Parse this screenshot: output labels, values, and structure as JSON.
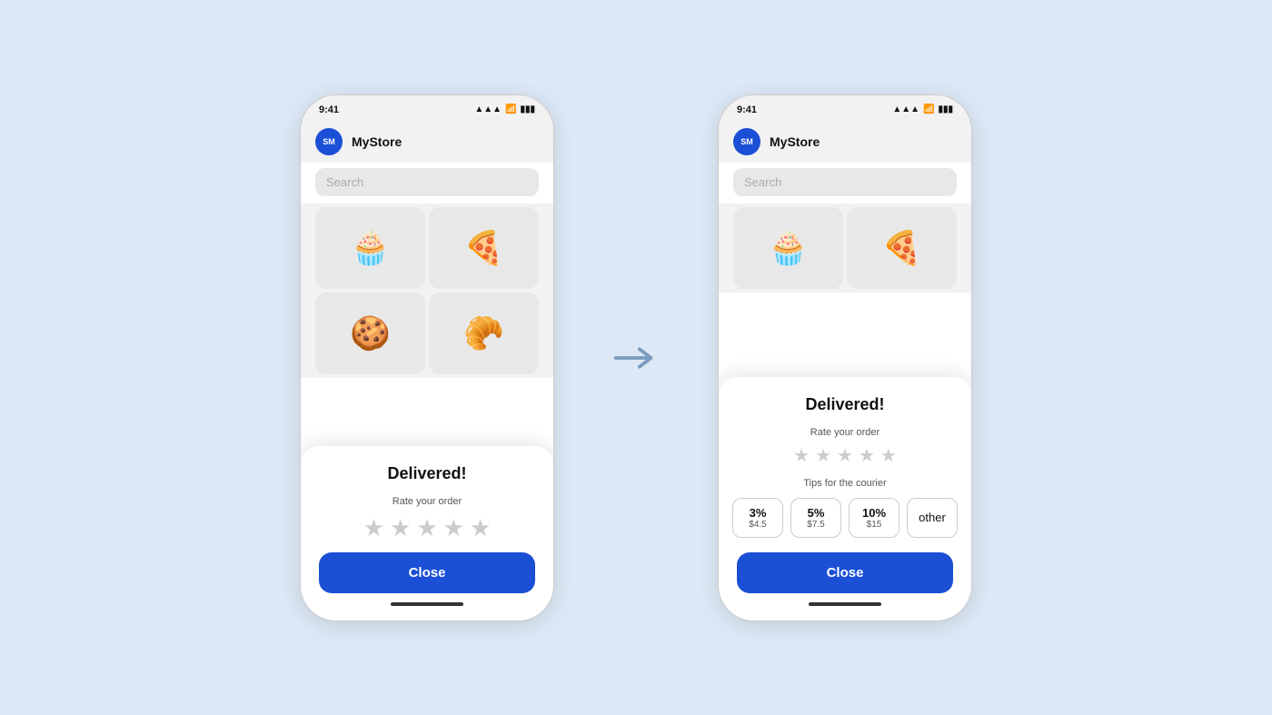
{
  "background": "#dce8f5",
  "phone1": {
    "status_time": "9:41",
    "signal_icon": "signal",
    "wifi_icon": "wifi",
    "battery_icon": "battery",
    "avatar_initials": "SM",
    "app_name": "MyStore",
    "search_placeholder": "Search",
    "grid_items": [
      "🧁",
      "🍕",
      "🍪",
      "🥐"
    ],
    "modal": {
      "title": "Delivered!",
      "rate_label": "Rate your order",
      "stars": [
        "★",
        "★",
        "★",
        "★",
        "★"
      ],
      "close_label": "Close"
    }
  },
  "phone2": {
    "status_time": "9:41",
    "avatar_initials": "SM",
    "app_name": "MyStore",
    "search_placeholder": "Search",
    "grid_items": [
      "🧁",
      "🍕"
    ],
    "modal": {
      "title": "Delivered!",
      "rate_label": "Rate your order",
      "stars": [
        "★",
        "★",
        "★",
        "★",
        "★"
      ],
      "tips_label": "Tips for the courier",
      "tips": [
        {
          "pct": "3%",
          "amt": "$4.5"
        },
        {
          "pct": "5%",
          "amt": "$7.5"
        },
        {
          "pct": "10%",
          "amt": "$15"
        }
      ],
      "other_label": "other",
      "close_label": "Close"
    }
  }
}
